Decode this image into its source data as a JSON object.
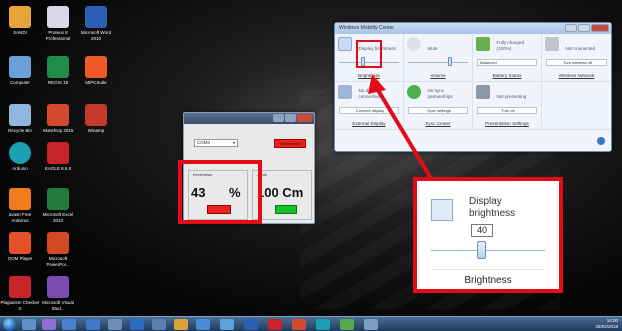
{
  "desktop": {
    "icons": [
      {
        "label": "SANDI",
        "color": "#e8a43a"
      },
      {
        "label": "Proteus 8 Professional",
        "color": "#d8d8e8"
      },
      {
        "label": "Microsoft Word 2010",
        "color": "#2b5fb3"
      },
      {
        "label": "Computer",
        "color": "#6aa0d8"
      },
      {
        "label": "REGIS 18",
        "color": "#1f8c48"
      },
      {
        "label": "MiPCSuite",
        "color": "#f05a28"
      },
      {
        "label": "Recycle Bin",
        "color": "#8fb6de"
      },
      {
        "label": "SketchUp 2015",
        "color": "#d24a2e"
      },
      {
        "label": "Winamp",
        "color": "#c33a2c"
      },
      {
        "label": "Arduino",
        "color": "#1aa0b0"
      },
      {
        "label": "EAGLE 6.6.0",
        "color": "#c9242b"
      },
      {
        "label": "avast! Free Antivirus",
        "color": "#f07b1c"
      },
      {
        "label": "Microsoft Excel 2010",
        "color": "#1f7a3c"
      },
      {
        "label": "GOM Player",
        "color": "#e4502a"
      },
      {
        "label": "Microsoft PowerPoi...",
        "color": "#d04a24"
      },
      {
        "label": "Plagiarism Checker X",
        "color": "#c6242a"
      },
      {
        "label": "Microsoft Visual Stud...",
        "color": "#7a4bb0"
      }
    ]
  },
  "mobility": {
    "title": "Windows Mobility Center",
    "tiles": [
      {
        "title": "Display brightness",
        "control": "",
        "caption": "Brightness",
        "color": "#c9dbf3"
      },
      {
        "title": "Mute",
        "control": "",
        "caption": "Volume",
        "color": "#d9e1ec"
      },
      {
        "title": "Fully charged (100%)",
        "control": "Balanced",
        "caption": "Battery Status",
        "color": "#6ab04c"
      },
      {
        "title": "Not connected",
        "control": "Turn wireless off",
        "caption": "Wireless Network",
        "color": "#c0c6cf"
      },
      {
        "title": "No display connected",
        "control": "Connect display",
        "caption": "External Display",
        "color": "#9fb7d6"
      },
      {
        "title": "No sync partnerships",
        "control": "Sync settings",
        "caption": "Sync Center",
        "color": "#4db04a"
      },
      {
        "title": "Not presenting",
        "control": "Turn on",
        "caption": "Presentation Settings",
        "color": "#8a98a8"
      },
      {
        "title": "",
        "control": "",
        "caption": "",
        "color": "#f1f5fb"
      }
    ]
  },
  "app": {
    "port": "COM4",
    "disconnect_label": "Disconnect",
    "left_group": {
      "legend": "Kecerahan",
      "value": "43",
      "unit": "%"
    },
    "right_group": {
      "legend": "Jarak",
      "value": "100 Cm"
    }
  },
  "zoom": {
    "title": "Display brightness",
    "value": "40",
    "caption": "Brightness"
  },
  "taskbar": {
    "time": "14:00",
    "date": "25/02/2016"
  },
  "colors": {
    "highlight": "#e30b18",
    "red_button": "#e52420",
    "green_button": "#15c326"
  }
}
